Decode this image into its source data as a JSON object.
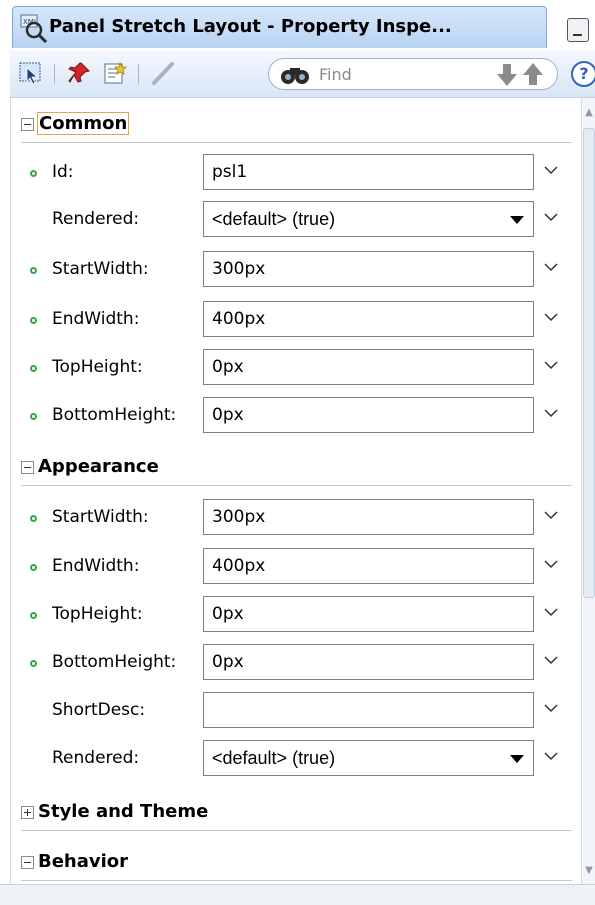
{
  "window": {
    "title": "Panel Stretch Layout - Property Inspe..."
  },
  "toolbar": {
    "find_placeholder": "Find"
  },
  "sections": {
    "common": {
      "label": "Common"
    },
    "appearance": {
      "label": "Appearance"
    },
    "style": {
      "label": "Style and Theme"
    },
    "behavior": {
      "label": "Behavior"
    }
  },
  "common": {
    "id": {
      "label": "Id:",
      "value": "psl1"
    },
    "rendered": {
      "label": "Rendered:",
      "value": "<default> (true)"
    },
    "startwidth": {
      "label": "StartWidth:",
      "value": "300px"
    },
    "endwidth": {
      "label": "EndWidth:",
      "value": "400px"
    },
    "topheight": {
      "label": "TopHeight:",
      "value": "0px"
    },
    "bottomheight": {
      "label": "BottomHeight:",
      "value": "0px"
    }
  },
  "appearance": {
    "startwidth": {
      "label": "StartWidth:",
      "value": "300px"
    },
    "endwidth": {
      "label": "EndWidth:",
      "value": "400px"
    },
    "topheight": {
      "label": "TopHeight:",
      "value": "0px"
    },
    "bottomheight": {
      "label": "BottomHeight:",
      "value": "0px"
    },
    "shortdesc": {
      "label": "ShortDesc:",
      "value": ""
    },
    "rendered": {
      "label": "Rendered:",
      "value": "<default> (true)"
    }
  },
  "colors": {
    "accent": "#2f64b8",
    "set_indicator": "#3aa346",
    "focus_outline": "#e8a547"
  }
}
